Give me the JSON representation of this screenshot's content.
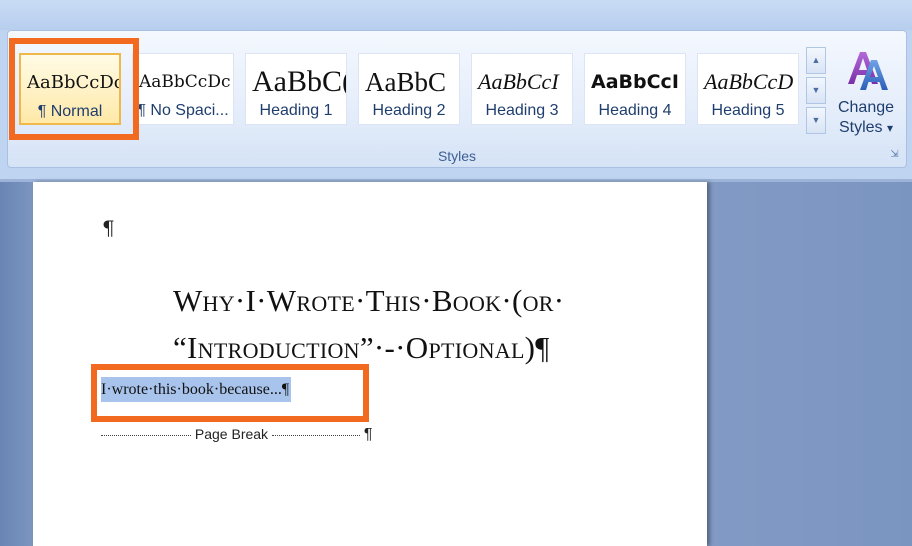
{
  "ribbon": {
    "group_label": "Styles",
    "styles": [
      {
        "preview": "AaBbCcDc",
        "label": "¶ Normal",
        "selected": true
      },
      {
        "preview": "AaBbCcDc",
        "label": "¶ No Spaci..."
      },
      {
        "preview": "AaBbC(",
        "label": "Heading 1"
      },
      {
        "preview": "AaBbC",
        "label": "Heading 2"
      },
      {
        "preview": "AaBbCcI",
        "label": "Heading 3"
      },
      {
        "preview": "AaBbCcI",
        "label": "Heading 4"
      },
      {
        "preview": "AaBbCcD",
        "label": "Heading 5"
      }
    ],
    "change_styles_label_1": "Change",
    "change_styles_label_2": "Styles",
    "change_styles_arrow": "▾"
  },
  "document": {
    "para_mark": "¶",
    "heading_line1": "Why·I·Wrote·This·Book·(or·",
    "heading_line2": "“Introduction”·-·Optional)¶",
    "body_text": "I·wrote·this·book·because...¶",
    "page_break_label": "Page Break",
    "page_break_mark": "¶"
  },
  "colors": {
    "highlight": "#f26a1f",
    "selection": "#a8c4ec"
  }
}
